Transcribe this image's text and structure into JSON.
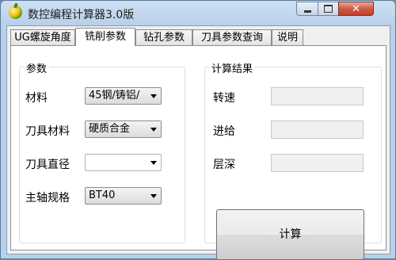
{
  "window": {
    "title": "数控编程计算器3.0版",
    "close_glyph": "✕"
  },
  "tabs": [
    "UG螺旋角度",
    "铣削参数",
    "钻孔参数",
    "刀具参数查询",
    "说明"
  ],
  "active_tab": 1,
  "params": {
    "group_title": "参数",
    "material": {
      "label": "材料",
      "value": "45钢/铸铝/"
    },
    "tool_material": {
      "label": "刀具材料",
      "value": "硬质合金"
    },
    "tool_diameter": {
      "label": "刀具直径",
      "value": ""
    },
    "spindle": {
      "label": "主轴规格",
      "value": "BT40"
    }
  },
  "results": {
    "group_title": "计算结果",
    "speed": {
      "label": "转速",
      "value": ""
    },
    "feed": {
      "label": "进给",
      "value": ""
    },
    "depth": {
      "label": "层深",
      "value": ""
    }
  },
  "calc_button": "计算"
}
